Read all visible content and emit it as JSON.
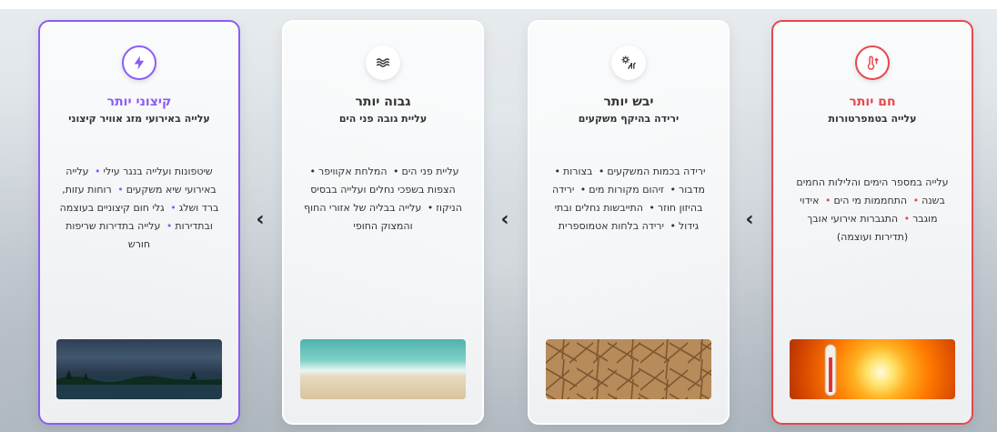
{
  "cards": [
    {
      "icon": "thermometer-up-icon",
      "title": "חם יותר",
      "subtitle": "עלייה בטמפרטורות",
      "items": [
        "עלייה במספר הימים והלילות החמים בשנה",
        "התחממות מי הים",
        "אידוי מוגבר",
        "התגברות אירועי אובך (תדירות ועוצמה)"
      ],
      "image": "sun-thermometer-image"
    },
    {
      "icon": "drought-icon",
      "title": "יבש יותר",
      "subtitle": "ירידה בהיקף משקעים",
      "items": [
        "ירידה בכמות המשקעים",
        "בצורות",
        "מדבור",
        "זיהום מקורות מים",
        "ירידה בהיזון חוזר",
        "התייבשות נחלים ובתי גידול",
        "ירידה בלחות אטמוספרית"
      ],
      "image": "cracked-earth-image"
    },
    {
      "icon": "waves-icon",
      "title": "גבוה יותר",
      "subtitle": "עליית גובה פני הים",
      "items": [
        "עליית פני הים",
        "המלחת אקוויפר",
        "הצפות בשפכי נחלים ועלייה בבסיס הניקוז",
        "עלייה בבליה של אזורי החוף והמצוק החופי"
      ],
      "image": "sea-shore-image"
    },
    {
      "icon": "lightning-icon",
      "title": "קיצוני יותר",
      "subtitle": "עלייה באירועי מזג אוויר קיצוני",
      "items": [
        "שיטפונות ועלייה בנגר עילי",
        "עלייה באירועי שיא משקעים",
        "רוחות עזות, ברד ושלג",
        "גלי חום קיצוניים בעוצמה ובתדירות",
        "עלייה בתדירות שריפות חורש"
      ],
      "image": "storm-clouds-image"
    }
  ],
  "colors": {
    "hot": "#e5484d",
    "extreme": "#8b5cf6"
  }
}
